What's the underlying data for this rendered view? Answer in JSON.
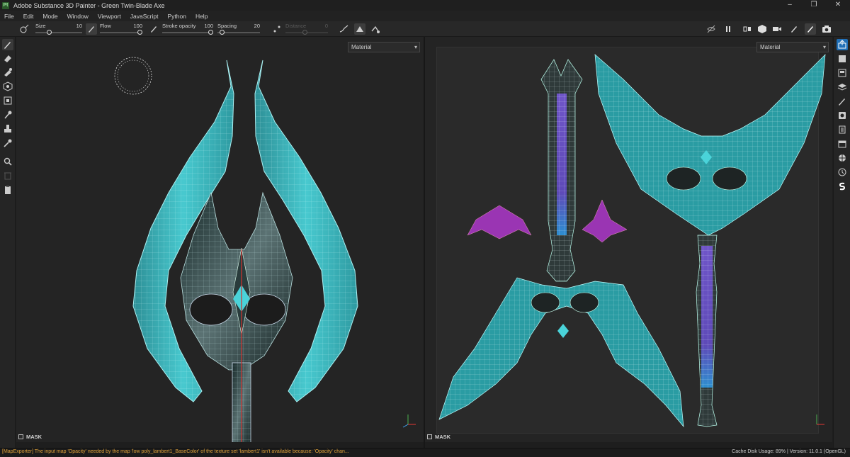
{
  "window": {
    "title": "Adobe Substance 3D Painter - Green Twin-Blade Axe",
    "logo_text": "Pt",
    "minimize": "–",
    "maximize": "❐",
    "close": "✕"
  },
  "menu": {
    "items": [
      "File",
      "Edit",
      "Mode",
      "Window",
      "Viewport",
      "JavaScript",
      "Python",
      "Help"
    ]
  },
  "toolbar": {
    "size": {
      "label": "Size",
      "value": "10"
    },
    "flow": {
      "label": "Flow",
      "value": "100"
    },
    "stroke_opacity": {
      "label": "Stroke opacity",
      "value": "100"
    },
    "spacing": {
      "label": "Spacing",
      "value": "20"
    },
    "distance": {
      "label": "Distance",
      "value": "0"
    }
  },
  "viewports": {
    "left": {
      "channel": "Material",
      "mask_label": "MASK"
    },
    "right": {
      "channel": "Material",
      "mask_label": "MASK"
    }
  },
  "status": {
    "message": "[MapExporter] The input map 'Opacity' needed by the map 'low poly_lambert1_BaseColor' of the texture set 'lambert1' isn't available because: 'Opacity' chan...",
    "cache_label": "Cache Disk Usage:",
    "cache_value": "89%",
    "version": "| Version: 11.0.1 (OpenGL)"
  },
  "colors": {
    "accent": "#1f6fb8",
    "blade": "#3fc1c9",
    "handle": "#6a4fc4",
    "gem": "#b03cc0",
    "warning": "#e0a23a"
  },
  "icons": {
    "left_tools": [
      "paint-brush-icon",
      "eraser-icon",
      "projection-icon",
      "geometry-fill-icon",
      "polygon-fill-icon",
      "smudge-icon",
      "clone-icon",
      "color-picker-icon",
      "bake-icon",
      "trash-icon",
      "clipboard-icon"
    ],
    "right_panels": [
      "export-icon",
      "layers-panel-icon",
      "texture-set-icon",
      "stack-icon",
      "brush-panel-icon",
      "display-settings-icon",
      "properties-icon",
      "assets-icon",
      "shelf-icon",
      "globe-icon",
      "history-icon",
      "substance-logo-icon"
    ]
  }
}
